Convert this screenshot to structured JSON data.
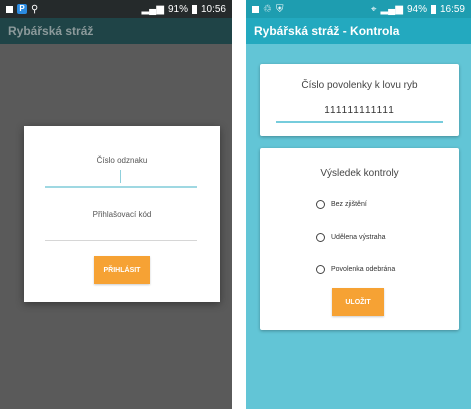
{
  "left": {
    "status_time": "10:56",
    "status_battery": "91%",
    "app_title": "Rybářská stráž",
    "login": {
      "badge_label": "Číslo odznaku",
      "code_label": "Přihlašovací kód",
      "login_button": "PŘIHLÁSIT"
    }
  },
  "right": {
    "status_time": "16:59",
    "status_battery": "94%",
    "app_title": "Rybářská stráž - Kontrola",
    "permit": {
      "label": "Číslo povolenky k lovu ryb",
      "value": "111111111111"
    },
    "result": {
      "title": "Výsledek kontroly",
      "options": [
        "Bez zjištění",
        "Udělena výstraha",
        "Povolenka odebrána"
      ],
      "save_button": "ULOŽIT"
    }
  },
  "colors": {
    "accent_orange": "#f6a234",
    "teal_primary": "#23a9bf",
    "teal_background": "#62c5d6"
  }
}
